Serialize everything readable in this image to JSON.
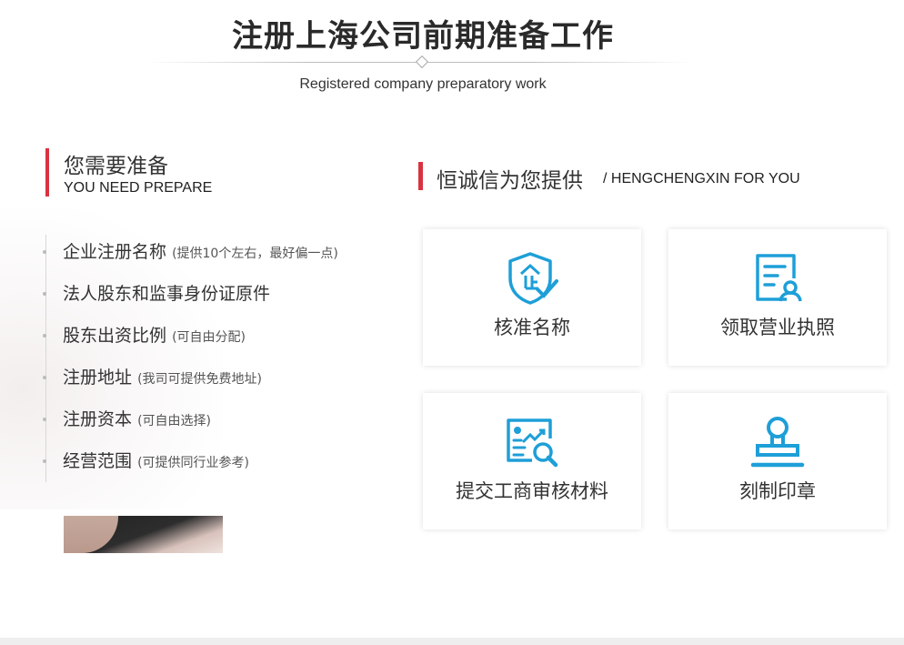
{
  "header": {
    "title": "注册上海公司前期准备工作",
    "subtitle": "Registered company preparatory work"
  },
  "prepare": {
    "title_cn": "您需要准备",
    "title_en": "YOU NEED PREPARE",
    "items": [
      {
        "text": "企业注册名称",
        "note": "(提供10个左右，最好偏一点)"
      },
      {
        "text": "法人股东和监事身份证原件",
        "note": ""
      },
      {
        "text": "股东出资比例",
        "note": "(可自由分配)"
      },
      {
        "text": "注册地址",
        "note": "(我司可提供免费地址)"
      },
      {
        "text": "注册资本",
        "note": "(可自由选择)"
      },
      {
        "text": "经营范围",
        "note": "(可提供同行业参考)"
      }
    ]
  },
  "provide": {
    "title_cn": "恒诚信为您提供",
    "title_en": "/ HENGCHENGXIN FOR YOU",
    "cards": [
      {
        "label": "核准名称",
        "icon": "shield-enterprise-icon"
      },
      {
        "label": "领取营业执照",
        "icon": "license-user-icon"
      },
      {
        "label": "提交工商审核材料",
        "icon": "document-search-icon"
      },
      {
        "label": "刻制印章",
        "icon": "stamp-icon"
      }
    ]
  },
  "colors": {
    "accent_red": "#d9333f",
    "icon_blue": "#1e9fd8"
  }
}
